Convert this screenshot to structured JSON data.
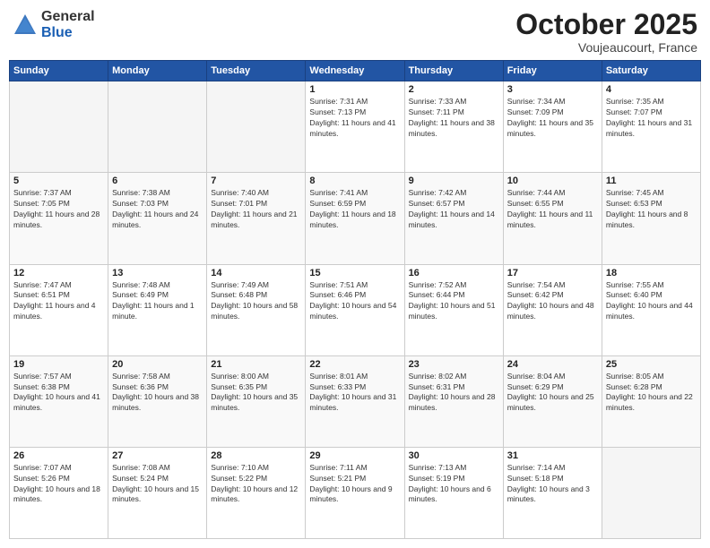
{
  "header": {
    "logo_general": "General",
    "logo_blue": "Blue",
    "month": "October 2025",
    "location": "Voujeaucourt, France"
  },
  "days_of_week": [
    "Sunday",
    "Monday",
    "Tuesday",
    "Wednesday",
    "Thursday",
    "Friday",
    "Saturday"
  ],
  "weeks": [
    [
      {
        "day": "",
        "empty": true
      },
      {
        "day": "",
        "empty": true
      },
      {
        "day": "",
        "empty": true
      },
      {
        "day": "1",
        "sunrise": "7:31 AM",
        "sunset": "7:13 PM",
        "daylight": "11 hours and 41 minutes."
      },
      {
        "day": "2",
        "sunrise": "7:33 AM",
        "sunset": "7:11 PM",
        "daylight": "11 hours and 38 minutes."
      },
      {
        "day": "3",
        "sunrise": "7:34 AM",
        "sunset": "7:09 PM",
        "daylight": "11 hours and 35 minutes."
      },
      {
        "day": "4",
        "sunrise": "7:35 AM",
        "sunset": "7:07 PM",
        "daylight": "11 hours and 31 minutes."
      }
    ],
    [
      {
        "day": "5",
        "sunrise": "7:37 AM",
        "sunset": "7:05 PM",
        "daylight": "11 hours and 28 minutes."
      },
      {
        "day": "6",
        "sunrise": "7:38 AM",
        "sunset": "7:03 PM",
        "daylight": "11 hours and 24 minutes."
      },
      {
        "day": "7",
        "sunrise": "7:40 AM",
        "sunset": "7:01 PM",
        "daylight": "11 hours and 21 minutes."
      },
      {
        "day": "8",
        "sunrise": "7:41 AM",
        "sunset": "6:59 PM",
        "daylight": "11 hours and 18 minutes."
      },
      {
        "day": "9",
        "sunrise": "7:42 AM",
        "sunset": "6:57 PM",
        "daylight": "11 hours and 14 minutes."
      },
      {
        "day": "10",
        "sunrise": "7:44 AM",
        "sunset": "6:55 PM",
        "daylight": "11 hours and 11 minutes."
      },
      {
        "day": "11",
        "sunrise": "7:45 AM",
        "sunset": "6:53 PM",
        "daylight": "11 hours and 8 minutes."
      }
    ],
    [
      {
        "day": "12",
        "sunrise": "7:47 AM",
        "sunset": "6:51 PM",
        "daylight": "11 hours and 4 minutes."
      },
      {
        "day": "13",
        "sunrise": "7:48 AM",
        "sunset": "6:49 PM",
        "daylight": "11 hours and 1 minute."
      },
      {
        "day": "14",
        "sunrise": "7:49 AM",
        "sunset": "6:48 PM",
        "daylight": "10 hours and 58 minutes."
      },
      {
        "day": "15",
        "sunrise": "7:51 AM",
        "sunset": "6:46 PM",
        "daylight": "10 hours and 54 minutes."
      },
      {
        "day": "16",
        "sunrise": "7:52 AM",
        "sunset": "6:44 PM",
        "daylight": "10 hours and 51 minutes."
      },
      {
        "day": "17",
        "sunrise": "7:54 AM",
        "sunset": "6:42 PM",
        "daylight": "10 hours and 48 minutes."
      },
      {
        "day": "18",
        "sunrise": "7:55 AM",
        "sunset": "6:40 PM",
        "daylight": "10 hours and 44 minutes."
      }
    ],
    [
      {
        "day": "19",
        "sunrise": "7:57 AM",
        "sunset": "6:38 PM",
        "daylight": "10 hours and 41 minutes."
      },
      {
        "day": "20",
        "sunrise": "7:58 AM",
        "sunset": "6:36 PM",
        "daylight": "10 hours and 38 minutes."
      },
      {
        "day": "21",
        "sunrise": "8:00 AM",
        "sunset": "6:35 PM",
        "daylight": "10 hours and 35 minutes."
      },
      {
        "day": "22",
        "sunrise": "8:01 AM",
        "sunset": "6:33 PM",
        "daylight": "10 hours and 31 minutes."
      },
      {
        "day": "23",
        "sunrise": "8:02 AM",
        "sunset": "6:31 PM",
        "daylight": "10 hours and 28 minutes."
      },
      {
        "day": "24",
        "sunrise": "8:04 AM",
        "sunset": "6:29 PM",
        "daylight": "10 hours and 25 minutes."
      },
      {
        "day": "25",
        "sunrise": "8:05 AM",
        "sunset": "6:28 PM",
        "daylight": "10 hours and 22 minutes."
      }
    ],
    [
      {
        "day": "26",
        "sunrise": "7:07 AM",
        "sunset": "5:26 PM",
        "daylight": "10 hours and 18 minutes."
      },
      {
        "day": "27",
        "sunrise": "7:08 AM",
        "sunset": "5:24 PM",
        "daylight": "10 hours and 15 minutes."
      },
      {
        "day": "28",
        "sunrise": "7:10 AM",
        "sunset": "5:22 PM",
        "daylight": "10 hours and 12 minutes."
      },
      {
        "day": "29",
        "sunrise": "7:11 AM",
        "sunset": "5:21 PM",
        "daylight": "10 hours and 9 minutes."
      },
      {
        "day": "30",
        "sunrise": "7:13 AM",
        "sunset": "5:19 PM",
        "daylight": "10 hours and 6 minutes."
      },
      {
        "day": "31",
        "sunrise": "7:14 AM",
        "sunset": "5:18 PM",
        "daylight": "10 hours and 3 minutes."
      },
      {
        "day": "",
        "empty": true
      }
    ]
  ]
}
